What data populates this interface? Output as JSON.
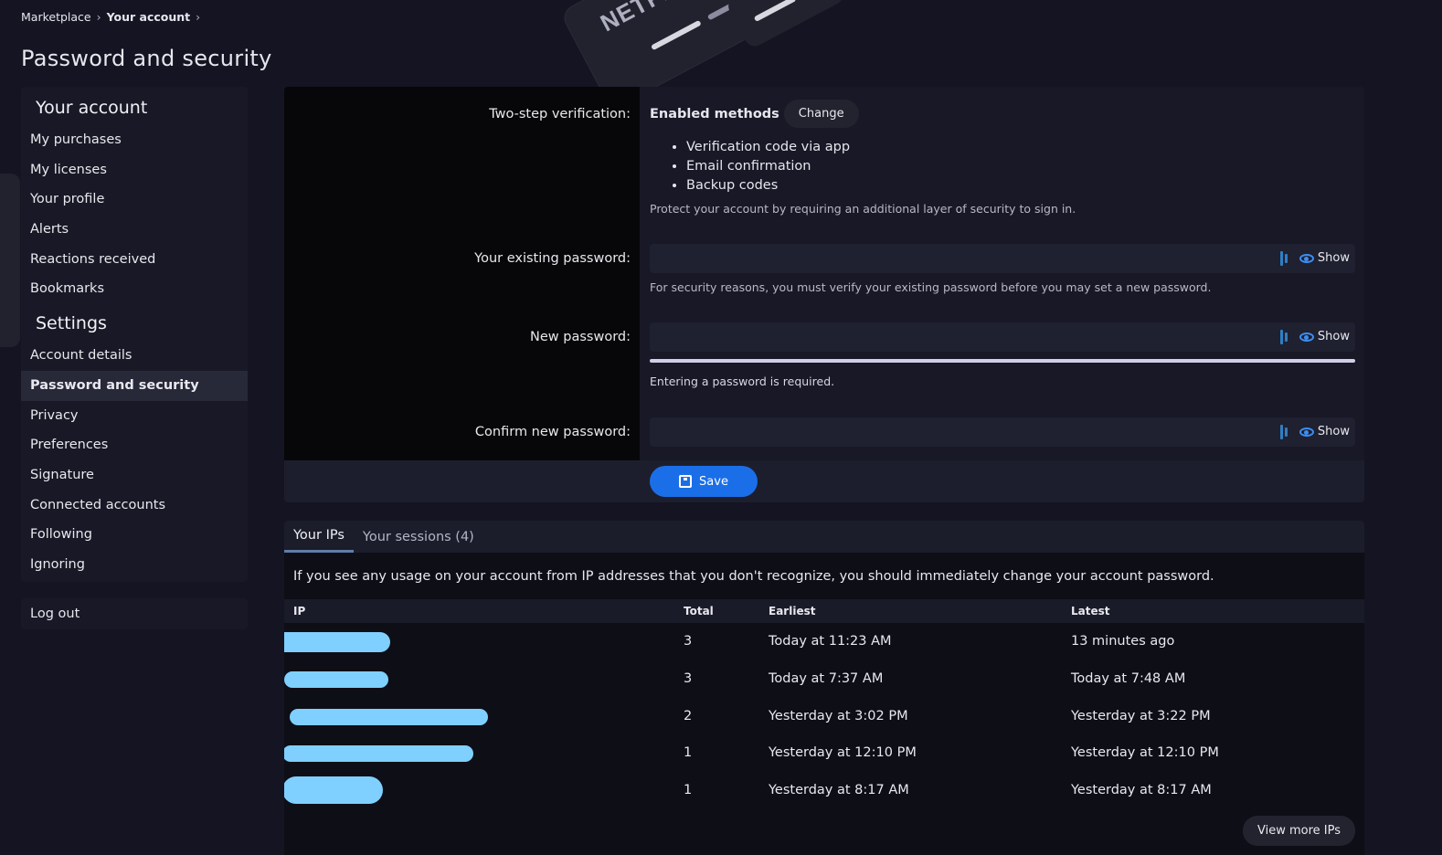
{
  "breadcrumb": {
    "root": "Marketplace",
    "current": "Your account"
  },
  "page_title": "Password and security",
  "sidebar": {
    "account_heading": "Your account",
    "account_items": [
      "My purchases",
      "My licenses",
      "Your profile",
      "Alerts",
      "Reactions received",
      "Bookmarks"
    ],
    "settings_heading": "Settings",
    "settings_items": [
      "Account details",
      "Password and security",
      "Privacy",
      "Preferences",
      "Signature",
      "Connected accounts",
      "Following",
      "Ignoring"
    ],
    "active_item": "Password and security",
    "logout": "Log out"
  },
  "form": {
    "two_step_label": "Two-step verification:",
    "enabled_methods": "Enabled methods",
    "change_button": "Change",
    "methods": [
      "Verification code via app",
      "Email confirmation",
      "Backup codes"
    ],
    "two_step_hint": "Protect your account by requiring an additional layer of security to sign in.",
    "existing_password_label": "Your existing password:",
    "existing_password_hint": "For security reasons, you must verify your existing password before you may set a new password.",
    "new_password_label": "New password:",
    "new_password_hint": "Entering a password is required.",
    "confirm_password_label": "Confirm new password:",
    "show_label": "Show",
    "save_button": "Save"
  },
  "ips": {
    "tabs": [
      "Your IPs",
      "Your sessions (4)"
    ],
    "notice": "If you see any usage on your account from IP addresses that you don't recognize, you should immediately change your account password.",
    "columns": [
      "IP",
      "Total",
      "Earliest",
      "Latest"
    ],
    "rows": [
      {
        "total": "3",
        "earliest": "Today at 11:23 AM",
        "latest": "13 minutes ago"
      },
      {
        "total": "3",
        "earliest": "Today at 7:37 AM",
        "latest": "Today at 7:48 AM"
      },
      {
        "total": "2",
        "earliest": "Yesterday at 3:02 PM",
        "latest": "Yesterday at 3:22 PM"
      },
      {
        "total": "1",
        "earliest": "Yesterday at 12:10 PM",
        "latest": "Yesterday at 12:10 PM"
      },
      {
        "total": "1",
        "earliest": "Yesterday at 8:17 AM",
        "latest": "Yesterday at 8:17 AM"
      }
    ],
    "view_more": "View more IPs"
  },
  "decor": {
    "card_text": "NETFLIX",
    "card_symbol": "$"
  },
  "colors": {
    "accent": "#1a6fe8",
    "redaction": "#7fd0ff",
    "background": "#141422"
  }
}
